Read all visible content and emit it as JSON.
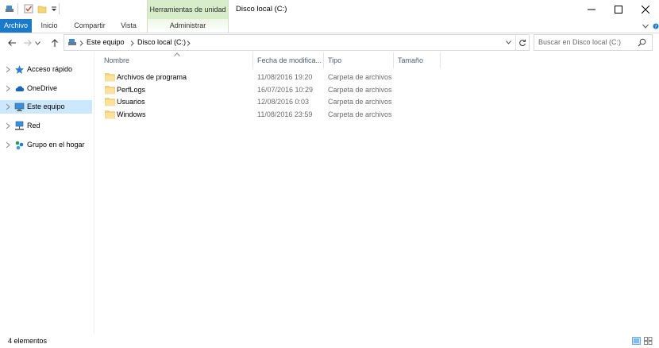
{
  "title_bar": {
    "context_tab_header": "Herramientas de unidad",
    "window_title": "Disco local (C:)"
  },
  "ribbon": {
    "tabs": [
      "Archivo",
      "Inicio",
      "Compartir",
      "Vista"
    ],
    "context_tab": "Administrar",
    "accent": "#1979ca",
    "context_color": "#d7ecc8"
  },
  "address_bar": {
    "breadcrumb": [
      "Este equipo",
      "Disco local (C:)"
    ]
  },
  "search": {
    "placeholder": "Buscar en Disco local (C:)"
  },
  "nav_pane": {
    "items": [
      {
        "label": "Acceso rápido",
        "icon": "star-icon"
      },
      {
        "label": "OneDrive",
        "icon": "cloud-icon"
      },
      {
        "label": "Este equipo",
        "icon": "computer-icon",
        "selected": true
      },
      {
        "label": "Red",
        "icon": "network-icon"
      },
      {
        "label": "Grupo en el hogar",
        "icon": "homegroup-icon"
      }
    ],
    "selected_color": "#cce8ff"
  },
  "file_list": {
    "columns": [
      "Nombre",
      "Fecha de modifica...",
      "Tipo",
      "Tamaño"
    ],
    "rows": [
      {
        "name": "Archivos de programa",
        "date": "11/08/2016 19:20",
        "type": "Carpeta de archivos"
      },
      {
        "name": "PerfLogs",
        "date": "16/07/2016 10:29",
        "type": "Carpeta de archivos"
      },
      {
        "name": "Usuarios",
        "date": "12/08/2016 0:03",
        "type": "Carpeta de archivos"
      },
      {
        "name": "Windows",
        "date": "11/08/2016 23:59",
        "type": "Carpeta de archivos"
      }
    ]
  },
  "status_bar": {
    "text": "4 elementos"
  }
}
